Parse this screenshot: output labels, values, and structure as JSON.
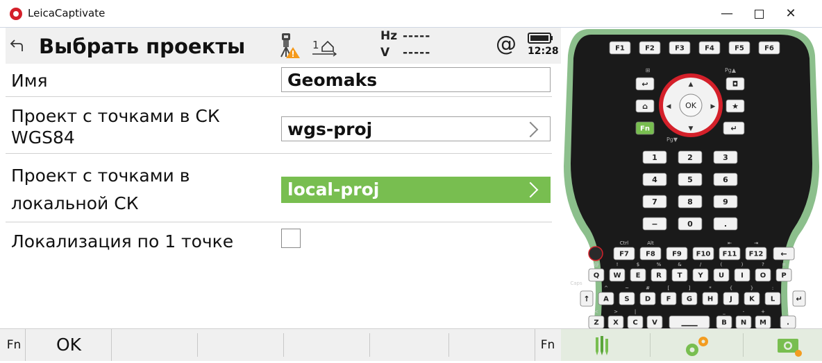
{
  "window": {
    "app_title": "LeicaCaptivate",
    "minimize": "—",
    "close": "✕"
  },
  "header": {
    "title": "Выбрать проекты",
    "hz_label": "Hz",
    "hz_value": "-----",
    "v_label": "V",
    "v_value": "-----",
    "at_symbol": "@",
    "time": "12:28",
    "station_number": "1"
  },
  "form": {
    "name_label": "Имя",
    "name_value": "Geomaks",
    "wgs_label_line1": "Проект с точками в СК",
    "wgs_label_line2": "WGS84",
    "wgs_value": "wgs-proj",
    "local_label_line1": "Проект с точками в",
    "local_label_line2": "локальной СК",
    "local_value": "local-proj",
    "onepoint_label": "Локализация по 1 точке",
    "onepoint_checked": false
  },
  "softkeys": {
    "fn": "Fn",
    "ok": "OK",
    "fn_right": "Fn"
  },
  "keypad": {
    "fkeys": [
      "F1",
      "F2",
      "F3",
      "F4",
      "F5",
      "F6"
    ],
    "ok_key": "OK",
    "fn_key": "Fn",
    "num_rows": [
      [
        "1",
        "2",
        "3"
      ],
      [
        "4",
        "5",
        "6"
      ],
      [
        "7",
        "8",
        "9"
      ],
      [
        "−",
        "0",
        "."
      ]
    ],
    "fkeys2": [
      "F7",
      "F8",
      "F9",
      "F10",
      "F11",
      "F12"
    ],
    "fkeys2_hints": [
      "Ctrl",
      "Alt",
      "",
      "",
      "⇤",
      "⇥"
    ],
    "qwerty": [
      "Q",
      "W",
      "E",
      "R",
      "T",
      "Y",
      "U",
      "I",
      "O",
      "P"
    ],
    "qwerty_hints": [
      "@",
      "!",
      "$",
      "%",
      "&",
      "/",
      "(",
      ")",
      "?",
      "="
    ],
    "asdf": [
      "A",
      "S",
      "D",
      "F",
      "G",
      "H",
      "J",
      "K",
      "L"
    ],
    "asdf_hints": [
      "^",
      "~",
      "#",
      "[",
      "]",
      "*",
      "{",
      "}",
      ":"
    ],
    "zxcv": [
      "Z",
      "X",
      "C",
      "V",
      "B",
      "N",
      "M",
      "."
    ],
    "zxcv_hints": [
      "<",
      ">",
      "|",
      "",
      "_",
      "-",
      "+",
      ","
    ],
    "caps_label": "Caps",
    "pg_up": "Pg▲",
    "pg_down": "Pg▼",
    "accent_color": "#78be50",
    "ring_color": "#d4202a",
    "shell_color": "#8cbf8c",
    "key_color": "#1e1e1e"
  },
  "keypad_bar": {
    "icons": [
      "survey-tools-icon",
      "settings-gears-icon",
      "camera-icon"
    ]
  }
}
